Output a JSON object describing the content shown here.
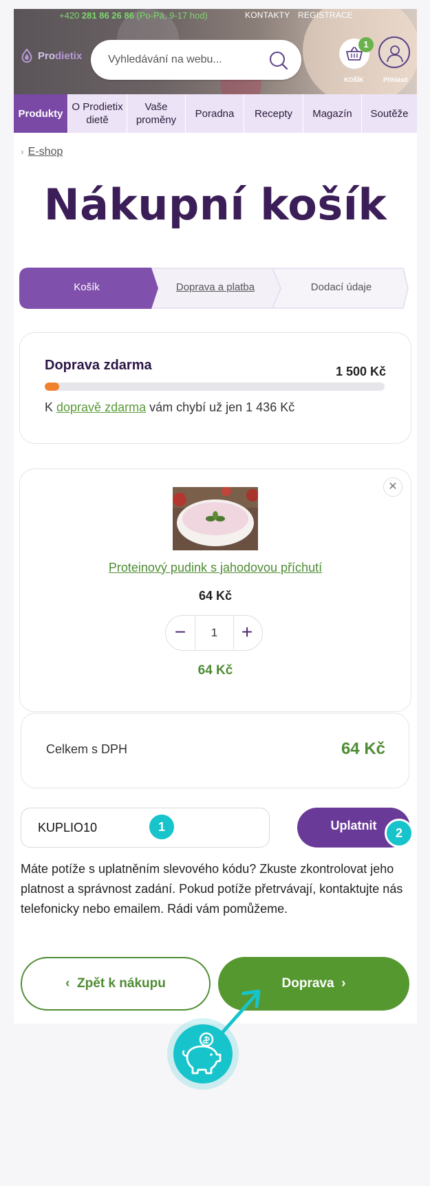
{
  "topbar": {
    "phone_prefix": "+420 ",
    "phone_number": "281 86 26 86",
    "phone_hours": " (Po-Pá, 9-17 hod)",
    "contacts_link": "KONTAKTY",
    "register_link": "REGISTRACE"
  },
  "logo": {
    "brand_a": "Pro",
    "brand_b": "dietix"
  },
  "search": {
    "placeholder": "Vyhledávání na webu..."
  },
  "cart": {
    "count": "1",
    "label": "KOŠÍK"
  },
  "user": {
    "label": "Přihlásit"
  },
  "nav": {
    "items": [
      "Produkty",
      "O Prodietix dietě",
      "Vaše proměny",
      "Poradna",
      "Recepty",
      "Magazín",
      "Soutěže"
    ]
  },
  "breadcrumb": {
    "link": "E-shop"
  },
  "page_title": "Nákupní košík",
  "steps": [
    "Košík",
    "Doprava a platba",
    "Dodací údaje"
  ],
  "free_shipping": {
    "title": "Doprava zdarma",
    "threshold": "1 500 Kč",
    "progress_fraction": 0.043,
    "note_prefix": "K ",
    "note_link": "dopravě zdarma",
    "note_suffix": " vám chybí už jen 1 436 Kč"
  },
  "cart_item": {
    "name": "Proteinový pudink s jahodovou příchutí",
    "unit_price": "64 Kč",
    "quantity": "1",
    "total": "64 Kč",
    "remove_icon": "close-icon"
  },
  "summary": {
    "label": "Celkem s DPH",
    "value": "64 Kč"
  },
  "coupon": {
    "value": "KUPLIO10",
    "apply_label": "Uplatnit",
    "badge_1": "1",
    "badge_2": "2",
    "help_text": "Máte potíže s uplatněním slevového kódu? Zkuste zkontrolovat jeho platnost a správnost zadání. Pokud potíže přetrvávají, kontaktujte nás telefonicky nebo emailem. Rádi vám pomůžeme."
  },
  "actions": {
    "back_label": "Zpět k nákupu",
    "next_label": "Doprava"
  },
  "colors": {
    "brand_purple": "#6a3a98",
    "title_purple": "#3b1d57",
    "green": "#55982f",
    "accent_teal": "#17c4cb",
    "progress_orange": "#f0822e"
  }
}
